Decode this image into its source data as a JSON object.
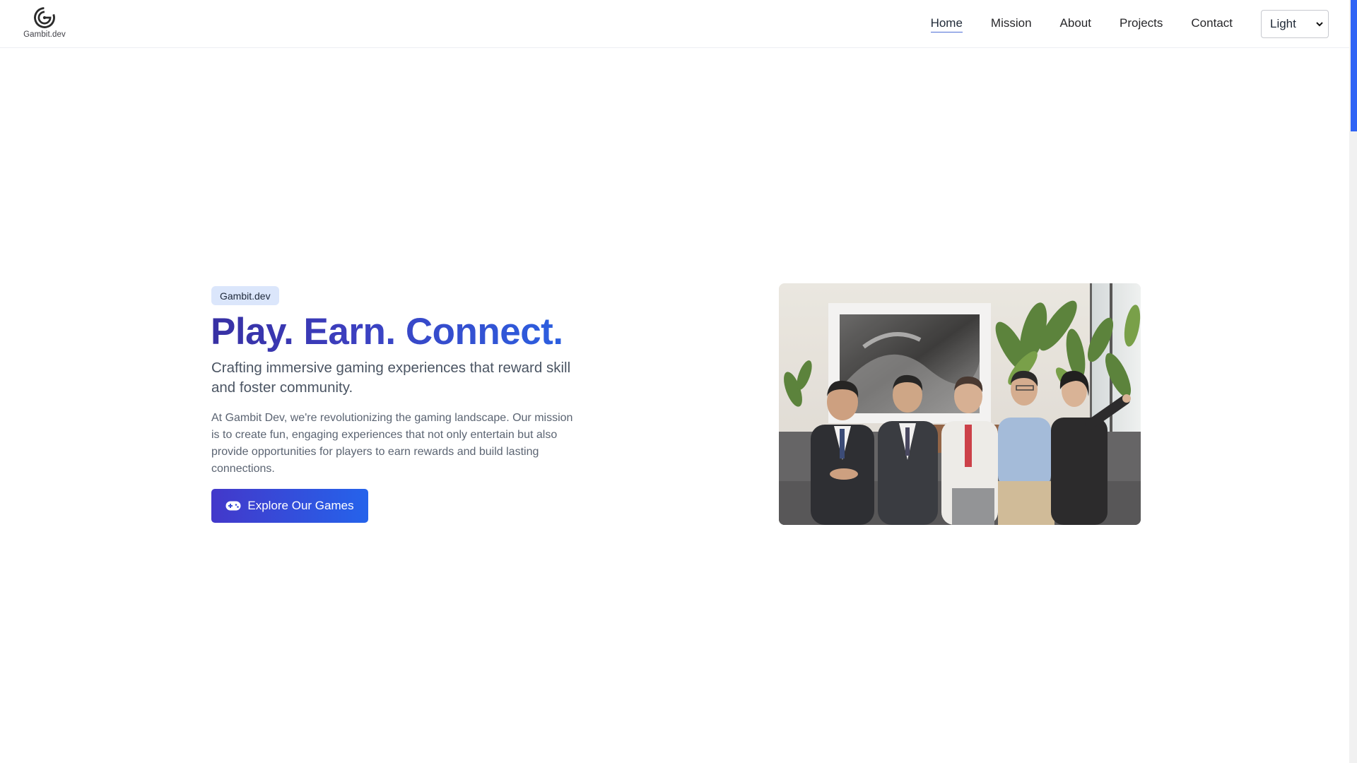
{
  "brand": {
    "name": "Gambit.dev",
    "logo_icon": "gambit-g-logo-icon"
  },
  "nav": {
    "items": [
      {
        "label": "Home",
        "active": true
      },
      {
        "label": "Mission",
        "active": false
      },
      {
        "label": "About",
        "active": false
      },
      {
        "label": "Projects",
        "active": false
      },
      {
        "label": "Contact",
        "active": false
      }
    ],
    "theme_select": {
      "selected": "Light",
      "icon": "chevron-down-icon"
    }
  },
  "hero": {
    "badge": "Gambit.dev",
    "headline": "Play. Earn. Connect.",
    "subtitle": "Crafting immersive gaming experiences that reward skill and foster community.",
    "body": "At Gambit Dev, we're revolutionizing the gaming landscape. Our mission is to create fun, engaging experiences that not only entertain but also provide opportunities for players to earn rewards and build lasting connections.",
    "cta": {
      "label": "Explore Our Games",
      "icon": "gamepad-icon"
    },
    "image": {
      "subject": "team-photo"
    }
  },
  "colors": {
    "accent": "#3b4fd8",
    "headline_gradient_start": "#3730a3",
    "headline_gradient_end": "#2c5fe0",
    "badge_bg": "#dbe6fb",
    "scrollbar_thumb": "#2f64f5"
  }
}
